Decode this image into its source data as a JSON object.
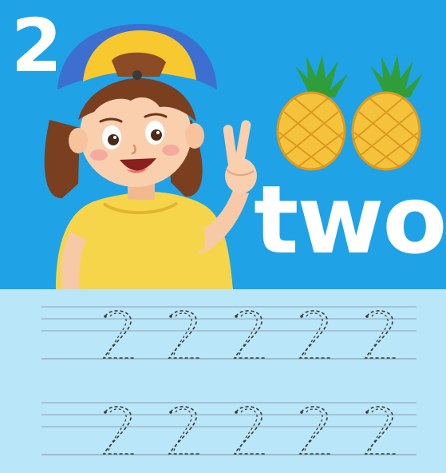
{
  "card": {
    "number": "2",
    "word": "two"
  },
  "colors": {
    "sky": "#1fa3e6",
    "practice_bg": "#b9e6f8",
    "guide_line": "#8fa2b0",
    "trace_dash": "#3a3a3a",
    "cap_yellow": "#f7c92e",
    "cap_blue": "#3c6fd0",
    "shirt": "#f7d54a",
    "pineapple_body": "#f5c33b",
    "pineapple_leaves": "#2f9e3a"
  },
  "illustrations": {
    "character": "girl-with-cap-showing-two-fingers",
    "fruit": "pineapple",
    "fruit_count": 2
  },
  "practice": {
    "rows": 2,
    "per_row": 5,
    "traced_digit": "2"
  }
}
